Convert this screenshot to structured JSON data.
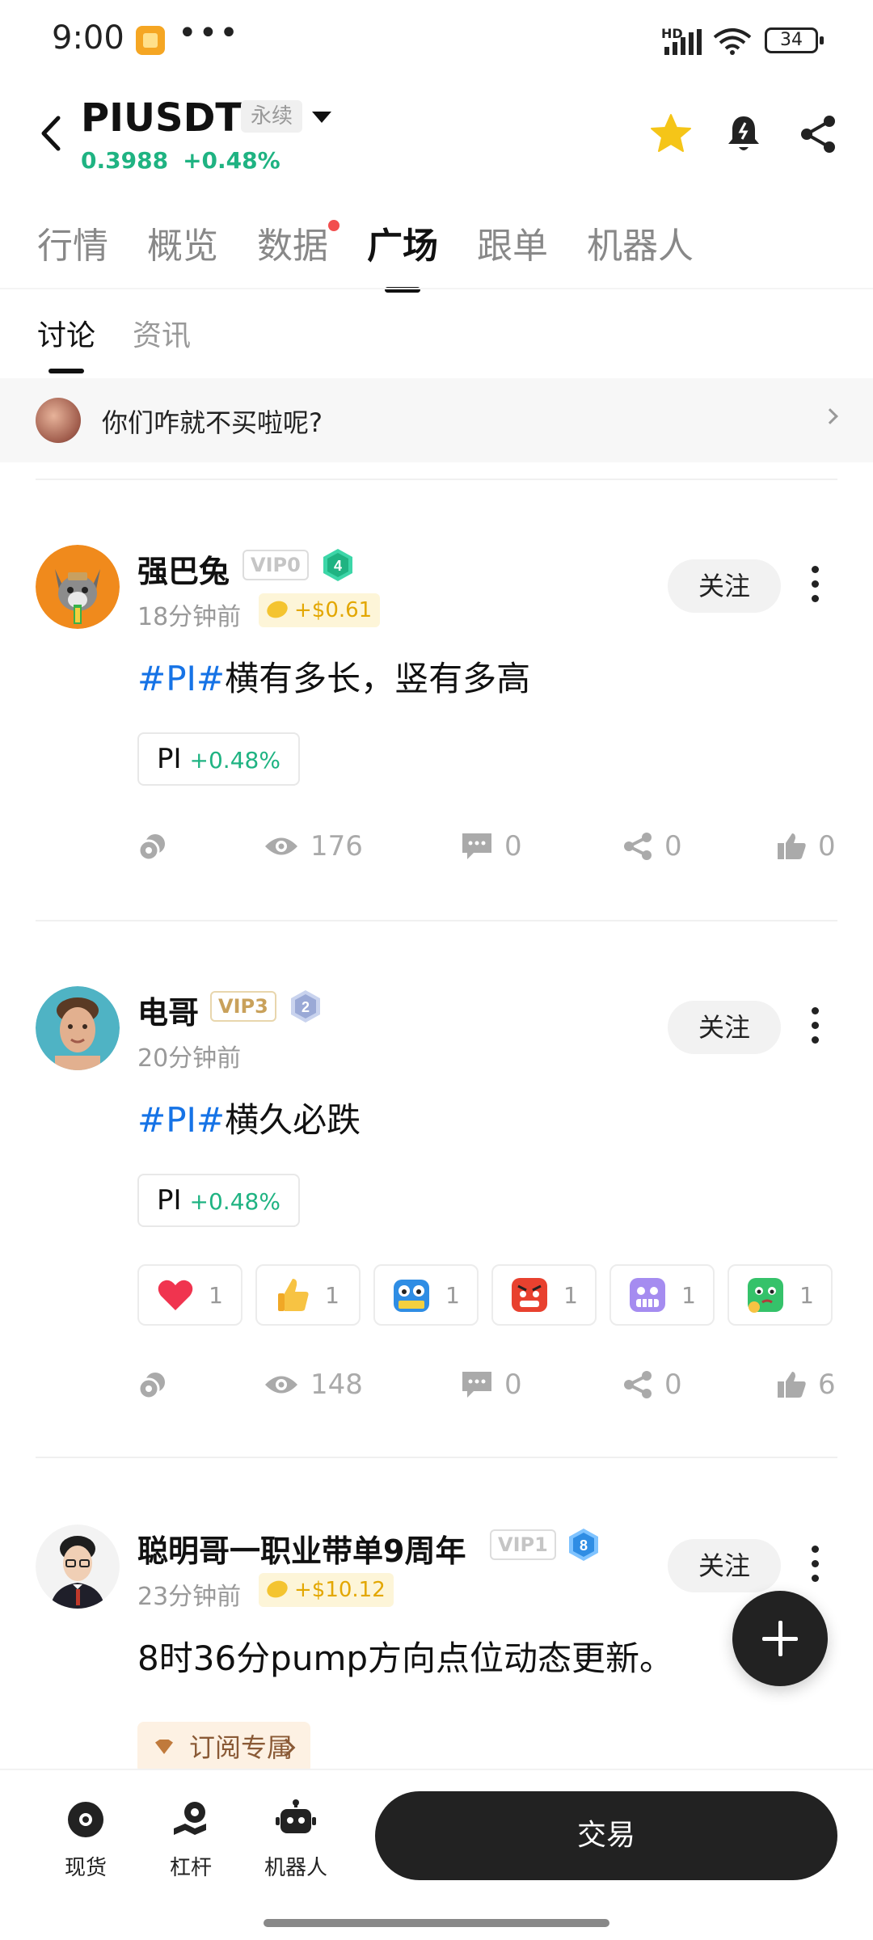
{
  "status_bar": {
    "time": "9:00",
    "dots": "•••",
    "hd": "HD",
    "battery": "34"
  },
  "header": {
    "pair": "PIUSDT",
    "contract_type": "永续",
    "price": "0.3988",
    "change": "+0.48%",
    "icons": [
      "back-icon",
      "star-icon",
      "bell-icon",
      "share-icon"
    ],
    "accent_color": "#1fb382",
    "star_color": "#f5c518"
  },
  "tabs": [
    {
      "label": "行情"
    },
    {
      "label": "概览"
    },
    {
      "label": "数据"
    },
    {
      "label": "广场"
    },
    {
      "label": "跟单"
    },
    {
      "label": "机器人"
    }
  ],
  "active_tab": "广场",
  "subtabs": [
    {
      "label": "讨论"
    },
    {
      "label": "资讯"
    }
  ],
  "pinned": {
    "text": "你们咋就不买啦呢?"
  },
  "posts": [
    {
      "username": "强巴兔",
      "vip": "VIP0",
      "level": "4",
      "time": "18分钟前",
      "earnings": "+$0.61",
      "follow_label": "关注",
      "hashtag": "#PI#",
      "text": "横有多长，竖有多高",
      "coin": {
        "symbol": "PI",
        "change": "+0.48%"
      },
      "stats": {
        "views": "176",
        "comments": "0",
        "shares": "0",
        "likes": "0"
      }
    },
    {
      "username": "电哥",
      "vip": "VIP3",
      "level": "2",
      "time": "20分钟前",
      "follow_label": "关注",
      "hashtag": "#PI#",
      "text": "横久必跌",
      "coin": {
        "symbol": "PI",
        "change": "+0.48%"
      },
      "reactions": [
        {
          "icon": "heart-emoji",
          "count": "1"
        },
        {
          "icon": "thumbs-up-emoji",
          "count": "1"
        },
        {
          "icon": "hodl-emoji",
          "count": "1"
        },
        {
          "icon": "angry-emoji",
          "count": "1"
        },
        {
          "icon": "grimace-emoji",
          "count": "1"
        },
        {
          "icon": "thinking-emoji",
          "count": "1"
        }
      ],
      "stats": {
        "views": "148",
        "comments": "0",
        "shares": "0",
        "likes": "6"
      }
    },
    {
      "username": "聪明哥一职业带单9周年",
      "vip": "VIP1",
      "level": "8",
      "time": "23分钟前",
      "earnings": "+$10.12",
      "follow_label": "关注",
      "text": "8时36分pump方向点位动态更新。",
      "subscribe_label": "订阅专属"
    }
  ],
  "bottom_bar": {
    "items": [
      {
        "label": "现货"
      },
      {
        "label": "杠杆"
      },
      {
        "label": "机器人"
      }
    ],
    "trade_label": "交易"
  }
}
